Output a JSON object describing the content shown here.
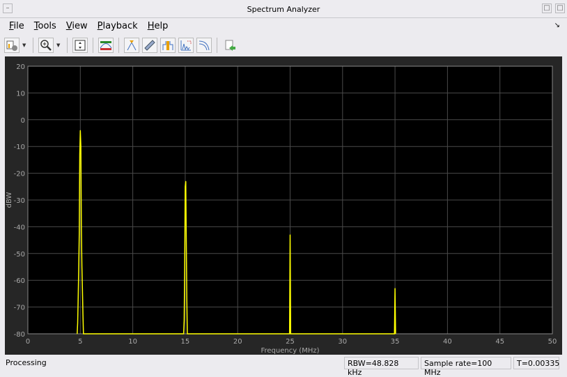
{
  "window": {
    "title": "Spectrum Analyzer"
  },
  "menu": [
    {
      "label": "File",
      "key": "F",
      "rest": "ile"
    },
    {
      "label": "Tools",
      "key": "T",
      "rest": "ools"
    },
    {
      "label": "View",
      "key": "V",
      "rest": "iew"
    },
    {
      "label": "Playback",
      "key": "P",
      "rest": "layback"
    },
    {
      "label": "Help",
      "key": "H",
      "rest": "elp"
    }
  ],
  "toolbar": {
    "icons": [
      "settings-icon",
      "zoom-in-icon",
      "scale-axes-icon",
      "spectrum-settings-icon",
      "peak-finder-icon",
      "measurement-icon",
      "channel-measurement-icon",
      "distortion-icon",
      "ccdf-icon",
      "export-icon"
    ]
  },
  "status": {
    "left": "Processing",
    "rbw": "RBW=48.828 kHz",
    "sample_rate": "Sample rate=100 MHz",
    "time": "T=0.00335"
  },
  "colors": {
    "trace": "#ffff00",
    "plot_bg": "#000000",
    "grid": "#4a4a4a",
    "panel": "#262626"
  },
  "chart_data": {
    "type": "line",
    "xlabel": "Frequency (MHz)",
    "ylabel": "dBW",
    "xlim": [
      0,
      50
    ],
    "ylim": [
      -80,
      20
    ],
    "xticks": [
      0,
      5,
      10,
      15,
      20,
      25,
      30,
      35,
      40,
      45,
      50
    ],
    "yticks": [
      20,
      10,
      0,
      -10,
      -20,
      -30,
      -40,
      -50,
      -60,
      -70,
      -80
    ],
    "grid": true,
    "series": [
      {
        "color": "#ffff00",
        "points": [
          [
            4.7,
            -80
          ],
          [
            4.75,
            -76
          ],
          [
            4.8,
            -66
          ],
          [
            4.85,
            -56
          ],
          [
            4.9,
            -42
          ],
          [
            4.95,
            -13
          ],
          [
            5.0,
            -4
          ],
          [
            5.05,
            -10
          ],
          [
            5.1,
            -40
          ],
          [
            5.15,
            -55
          ],
          [
            5.2,
            -63
          ],
          [
            5.25,
            -73
          ],
          [
            5.3,
            -80
          ],
          [
            14.85,
            -80
          ],
          [
            14.9,
            -75
          ],
          [
            14.95,
            -56
          ],
          [
            15.0,
            -25
          ],
          [
            15.05,
            -23
          ],
          [
            15.1,
            -44
          ],
          [
            15.15,
            -67
          ],
          [
            15.2,
            -80
          ],
          [
            24.95,
            -80
          ],
          [
            25.0,
            -43
          ],
          [
            25.05,
            -80
          ],
          [
            34.95,
            -80
          ],
          [
            35.0,
            -63
          ],
          [
            35.05,
            -80
          ]
        ]
      }
    ]
  }
}
